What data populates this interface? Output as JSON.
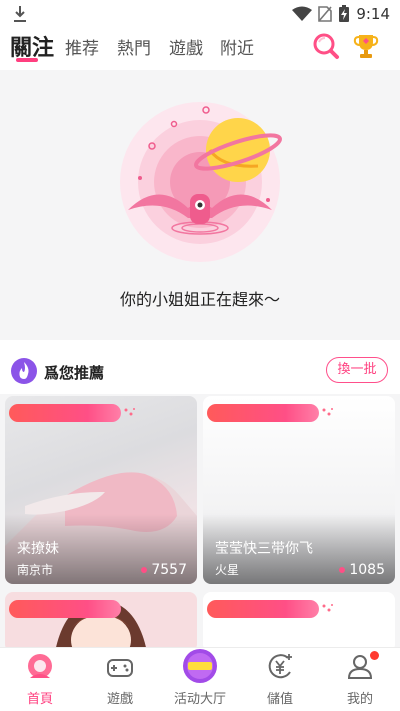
{
  "status_bar": {
    "time": "9:14"
  },
  "tabs": [
    {
      "label": "關注",
      "active": true
    },
    {
      "label": "推荐"
    },
    {
      "label": "熱門"
    },
    {
      "label": "遊戲"
    },
    {
      "label": "附近"
    }
  ],
  "empty_state": {
    "message": "你的小姐姐正在趕來～"
  },
  "recommend": {
    "title": "爲您推薦",
    "swap_button": "換一批",
    "cards": [
      {
        "name": "来撩妹",
        "city": "南京市",
        "heat": "7557"
      },
      {
        "name": "莹莹快三带你飞",
        "city": "火星",
        "heat": "1085"
      }
    ]
  },
  "bottom_nav": [
    {
      "label": "首頁",
      "active": true
    },
    {
      "label": "遊戲"
    },
    {
      "label": "活动大厅"
    },
    {
      "label": "儲值"
    },
    {
      "label": "我的"
    }
  ],
  "colors": {
    "accent": "#ff3f7f",
    "pill": "#ff5a5a"
  }
}
